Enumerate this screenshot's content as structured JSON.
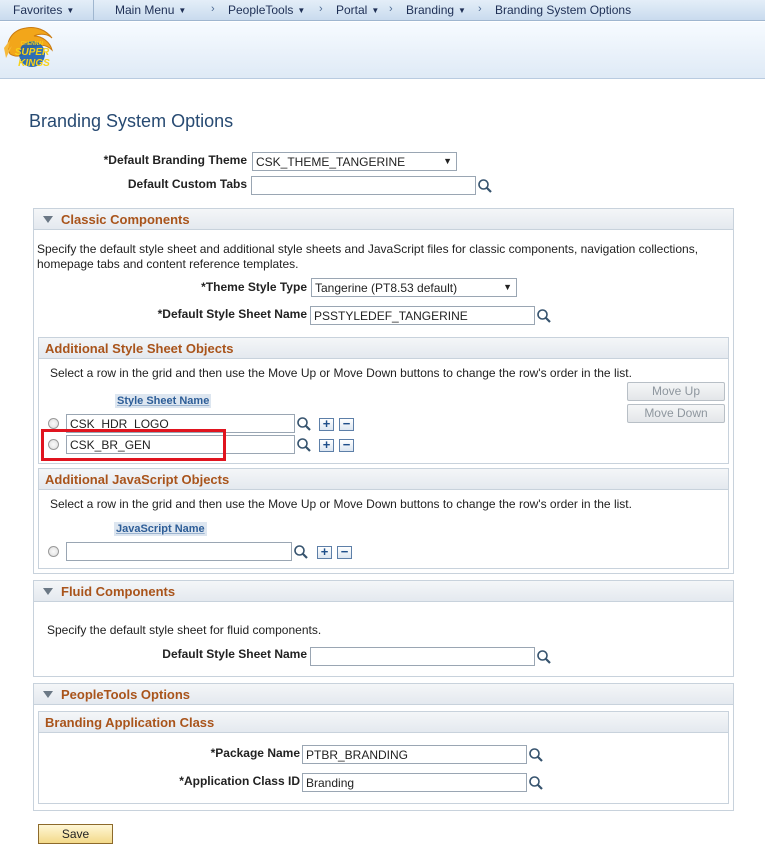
{
  "nav": {
    "favorites": "Favorites",
    "main_menu": "Main Menu",
    "crumbs": [
      "PeopleTools",
      "Portal",
      "Branding",
      "Branding System Options"
    ],
    "separator": "›"
  },
  "banner": {
    "logo_top": "CHENNAI",
    "logo_mid": "SUPER",
    "logo_bottom": "KINGS"
  },
  "page_title": "Branding System Options",
  "theme": {
    "label": "*Default Branding Theme",
    "value": "CSK_THEME_TANGERINE"
  },
  "custom_tabs": {
    "label": "Default Custom Tabs",
    "value": ""
  },
  "classic": {
    "title": "Classic Components",
    "description_line1": "Specify the default style sheet and additional style sheets and JavaScript files for classic components, navigation collections,",
    "description_line2": "homepage tabs and content reference templates.",
    "theme_style_type": {
      "label": "*Theme Style Type",
      "value": "Tangerine (PT8.53 default)"
    },
    "default_style_sheet": {
      "label": "*Default Style Sheet Name",
      "value": "PSSTYLEDEF_TANGERINE"
    }
  },
  "style_sheets": {
    "title": "Additional Style Sheet Objects",
    "instruction": "Select a row in the grid and then use the Move Up or Move Down buttons to change the row's order in the list.",
    "column_header": "Style Sheet Name",
    "rows": [
      {
        "value": "CSK_HDR_LOGO"
      },
      {
        "value": "CSK_BR_GEN"
      }
    ],
    "move_up": "Move Up",
    "move_down": "Move Down"
  },
  "javascript": {
    "title": "Additional JavaScript Objects",
    "instruction": "Select a row in the grid and then use the Move Up or Move Down buttons to change the row's order in the list.",
    "column_header": "JavaScript Name",
    "rows": [
      {
        "value": ""
      }
    ]
  },
  "fluid": {
    "title": "Fluid Components",
    "description": "Specify the default style sheet for fluid components.",
    "default_style_sheet": {
      "label": "Default Style Sheet Name",
      "value": ""
    }
  },
  "peopletools": {
    "title": "PeopleTools Options",
    "app_class_title": "Branding Application Class",
    "package": {
      "label": "*Package Name",
      "value": "PTBR_BRANDING"
    },
    "app_class": {
      "label": "*Application Class ID",
      "value": "Branding"
    }
  },
  "buttons": {
    "save": "Save",
    "add": "+",
    "remove": "−"
  },
  "colors": {
    "accent": "#a9541b",
    "highlight": "#e0141f",
    "title": "#274a72"
  }
}
